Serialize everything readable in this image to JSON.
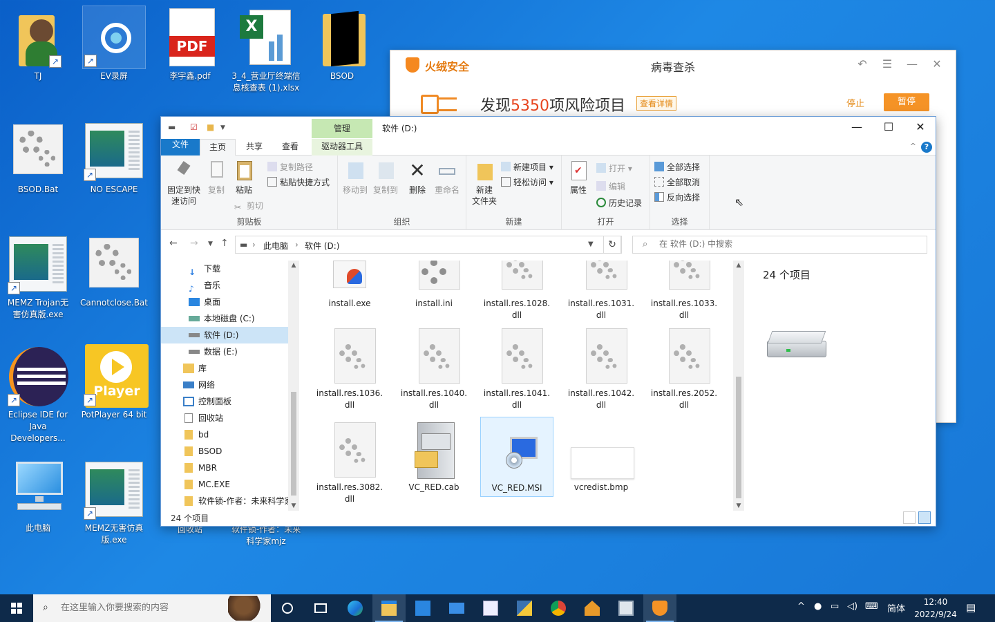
{
  "desktop": {
    "icons": [
      {
        "label": "TJ"
      },
      {
        "label": "EV录屏"
      },
      {
        "label": "李宇鑫.pdf",
        "badge": "PDF"
      },
      {
        "label": "3_4_营业厅终端信息核查表 (1).xlsx"
      },
      {
        "label": "BSOD"
      },
      {
        "label": "BSOD.Bat"
      },
      {
        "label": "NO ESCAPE"
      },
      {
        "label": "MEMZ Trojan无害仿真版.exe"
      },
      {
        "label": "Cannotclose.Bat"
      },
      {
        "label": "Eclipse IDE for Java Developers..."
      },
      {
        "label": "PotPlayer 64 bit",
        "badge": "Player"
      },
      {
        "label": "此电脑"
      },
      {
        "label": "MEMZ无害仿真版.exe"
      },
      {
        "label": "回收站"
      },
      {
        "label": "软件锁-作者：未来科学家mjz"
      }
    ]
  },
  "antivirus": {
    "brand": "火绒安全",
    "title": "病毒查杀",
    "found_prefix": "发现",
    "found_count": "5350",
    "found_suffix": "项风险项目",
    "detail_button": "查看详情",
    "stop_button": "停止",
    "pause_button": "暂停",
    "controls": {
      "back": "↶",
      "menu": "☰",
      "minimize": "—",
      "close": "✕"
    }
  },
  "explorer": {
    "title": "软件 (D:)",
    "context_tab": "管理",
    "tabs": {
      "file": "文件",
      "home": "主页",
      "share": "共享",
      "view": "查看",
      "drive_tools": "驱动器工具"
    },
    "controls": {
      "minimize": "—",
      "maximize": "☐",
      "close": "✕",
      "help": "?",
      "collapse": "^"
    },
    "ribbon": {
      "clipboard": {
        "label": "剪贴板",
        "pin": "固定到快\n速访问",
        "copy": "复制",
        "paste": "粘贴",
        "copy_path": "复制路径",
        "paste_shortcut": "粘贴快捷方式",
        "cut": "剪切"
      },
      "organize": {
        "label": "组织",
        "move_to": "移动到",
        "copy_to": "复制到",
        "delete": "删除",
        "rename": "重命名"
      },
      "new": {
        "label": "新建",
        "new_folder": "新建\n文件夹",
        "new_item": "新建项目",
        "easy_access": "轻松访问"
      },
      "open": {
        "label": "打开",
        "properties": "属性",
        "open": "打开",
        "edit": "编辑",
        "history": "历史记录"
      },
      "select": {
        "label": "选择",
        "select_all": "全部选择",
        "select_none": "全部取消",
        "invert": "反向选择"
      }
    },
    "address": {
      "pc": "此电脑",
      "drive": "软件 (D:)"
    },
    "search_placeholder": "在 软件 (D:) 中搜索",
    "nav": [
      {
        "label": "下载",
        "icon": "download-icon"
      },
      {
        "label": "音乐",
        "icon": "music-icon"
      },
      {
        "label": "桌面",
        "icon": "desktop-icon"
      },
      {
        "label": "本地磁盘 (C:)",
        "icon": "drive-icon"
      },
      {
        "label": "软件 (D:)",
        "icon": "drive-icon",
        "selected": true
      },
      {
        "label": "数据 (E:)",
        "icon": "drive-icon"
      },
      {
        "label": "库",
        "icon": "library-icon"
      },
      {
        "label": "网络",
        "icon": "network-icon"
      },
      {
        "label": "控制面板",
        "icon": "control-panel-icon"
      },
      {
        "label": "回收站",
        "icon": "recycle-bin-icon"
      },
      {
        "label": "bd",
        "icon": "folder-icon"
      },
      {
        "label": "BSOD",
        "icon": "folder-icon"
      },
      {
        "label": "MBR",
        "icon": "folder-icon"
      },
      {
        "label": "MC.EXE",
        "icon": "folder-icon"
      },
      {
        "label": "软件锁-作者：未来科学家mjz",
        "icon": "folder-icon"
      }
    ],
    "files": [
      {
        "name": "install.exe"
      },
      {
        "name": "install.ini"
      },
      {
        "name": "install.res.1028.\ndll"
      },
      {
        "name": "install.res.1031.\ndll"
      },
      {
        "name": "install.res.1033.\ndll"
      },
      {
        "name": "install.res.1036.\ndll"
      },
      {
        "name": "install.res.1040.\ndll"
      },
      {
        "name": "install.res.1041.\ndll"
      },
      {
        "name": "install.res.1042.\ndll"
      },
      {
        "name": "install.res.2052.\ndll"
      },
      {
        "name": "install.res.3082.\ndll"
      },
      {
        "name": "VC_RED.cab"
      },
      {
        "name": "VC_RED.MSI",
        "selected": true
      },
      {
        "name": "vcredist.bmp"
      }
    ],
    "details_count": "24 个项目",
    "status": "24 个项目"
  },
  "taskbar": {
    "search_placeholder": "在这里输入你要搜索的内容",
    "ime": "简体",
    "time": "12:40",
    "date": "2022/9/24"
  },
  "colors": {
    "desktop_blue": "#1877d6",
    "accent": "#1979ca",
    "av_orange": "#f59326",
    "risk_red": "#e8441e"
  }
}
